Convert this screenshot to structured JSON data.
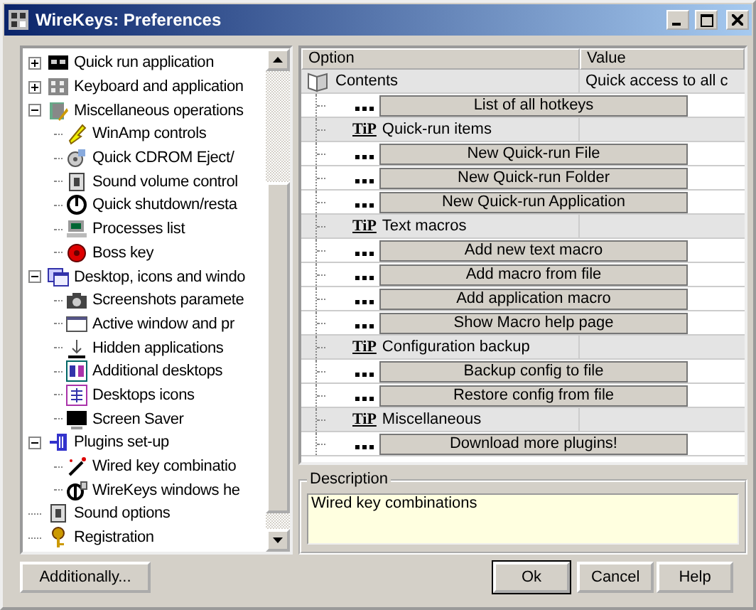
{
  "window": {
    "title": "WireKeys: Preferences"
  },
  "tree": [
    {
      "label": "Quick run application",
      "expanded": false
    },
    {
      "label": "Keyboard and application",
      "expanded": false
    },
    {
      "label": "Miscellaneous operations",
      "expanded": true,
      "children": [
        {
          "label": "WinAmp controls"
        },
        {
          "label": "Quick CDROM Eject/"
        },
        {
          "label": "Sound volume control"
        },
        {
          "label": "Quick shutdown/resta"
        },
        {
          "label": "Processes list"
        },
        {
          "label": "Boss key"
        }
      ]
    },
    {
      "label": "Desktop, icons and windo",
      "expanded": true,
      "children": [
        {
          "label": "Screenshots paramete"
        },
        {
          "label": "Active window and pr"
        },
        {
          "label": "Hidden applications"
        },
        {
          "label": "Additional desktops"
        },
        {
          "label": "Desktops icons"
        },
        {
          "label": "Screen Saver"
        }
      ]
    },
    {
      "label": "Plugins set-up",
      "expanded": true,
      "children": [
        {
          "label": "Wired key combinatio"
        },
        {
          "label": "WireKeys windows he"
        }
      ]
    },
    {
      "label": "Sound options"
    },
    {
      "label": "Registration"
    }
  ],
  "grid": {
    "columns": [
      "Option",
      "Value"
    ],
    "rows": [
      {
        "kind": "header",
        "label": "Contents",
        "value": "Quick access to all c"
      },
      {
        "kind": "action",
        "label": "List of all hotkeys"
      },
      {
        "kind": "group",
        "badge": "TiP",
        "label": "Quick-run items"
      },
      {
        "kind": "action",
        "label": "New Quick-run File"
      },
      {
        "kind": "action",
        "label": "New Quick-run Folder"
      },
      {
        "kind": "action",
        "label": "New Quick-run Application"
      },
      {
        "kind": "group",
        "badge": "TiP",
        "label": "Text macros"
      },
      {
        "kind": "action",
        "label": "Add new text macro"
      },
      {
        "kind": "action",
        "label": "Add macro from file"
      },
      {
        "kind": "action",
        "label": "Add application macro"
      },
      {
        "kind": "action",
        "label": "Show Macro help page"
      },
      {
        "kind": "group",
        "badge": "TiP",
        "label": "Configuration backup"
      },
      {
        "kind": "action",
        "label": "Backup config to file"
      },
      {
        "kind": "action",
        "label": "Restore config from file"
      },
      {
        "kind": "group",
        "badge": "TiP",
        "label": "Miscellaneous"
      },
      {
        "kind": "action",
        "label": "Download more plugins!"
      }
    ]
  },
  "description": {
    "title": "Description",
    "text": "Wired key combinations"
  },
  "buttons": {
    "left": "Additionally...",
    "right": [
      "Ok",
      "Cancel",
      "Help"
    ]
  }
}
